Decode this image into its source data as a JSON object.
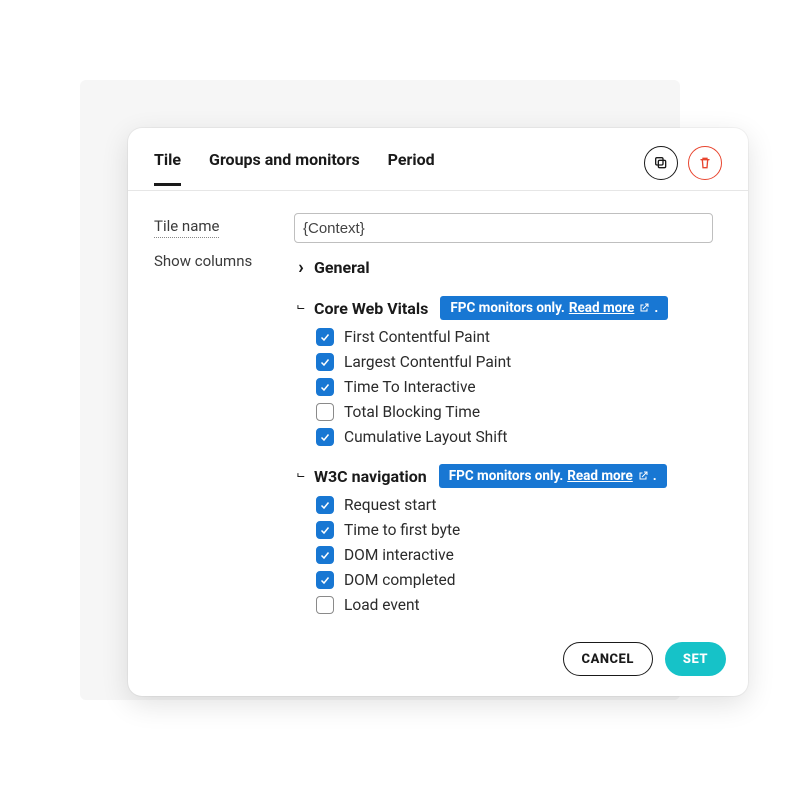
{
  "tabs": [
    "Tile",
    "Groups and monitors",
    "Period"
  ],
  "active_tab": 0,
  "labels": {
    "tile_name": "Tile name",
    "show_columns": "Show columns"
  },
  "tile_name_value": "{Context}",
  "badge": {
    "prefix": "FPC monitors only.",
    "link": "Read more"
  },
  "sections": [
    {
      "title": "General",
      "expanded": false,
      "badge": false,
      "items": []
    },
    {
      "title": "Core Web Vitals",
      "expanded": true,
      "badge": true,
      "items": [
        {
          "label": "First Contentful Paint",
          "checked": true
        },
        {
          "label": "Largest Contentful Paint",
          "checked": true
        },
        {
          "label": "Time To Interactive",
          "checked": true
        },
        {
          "label": "Total Blocking Time",
          "checked": false
        },
        {
          "label": "Cumulative Layout Shift",
          "checked": true
        }
      ]
    },
    {
      "title": "W3C navigation",
      "expanded": true,
      "badge": true,
      "items": [
        {
          "label": "Request start",
          "checked": true
        },
        {
          "label": "Time to first byte",
          "checked": true
        },
        {
          "label": "DOM interactive",
          "checked": true
        },
        {
          "label": "DOM completed",
          "checked": true
        },
        {
          "label": "Load event",
          "checked": false
        }
      ]
    }
  ],
  "buttons": {
    "cancel": "CANCEL",
    "set": "SET"
  }
}
